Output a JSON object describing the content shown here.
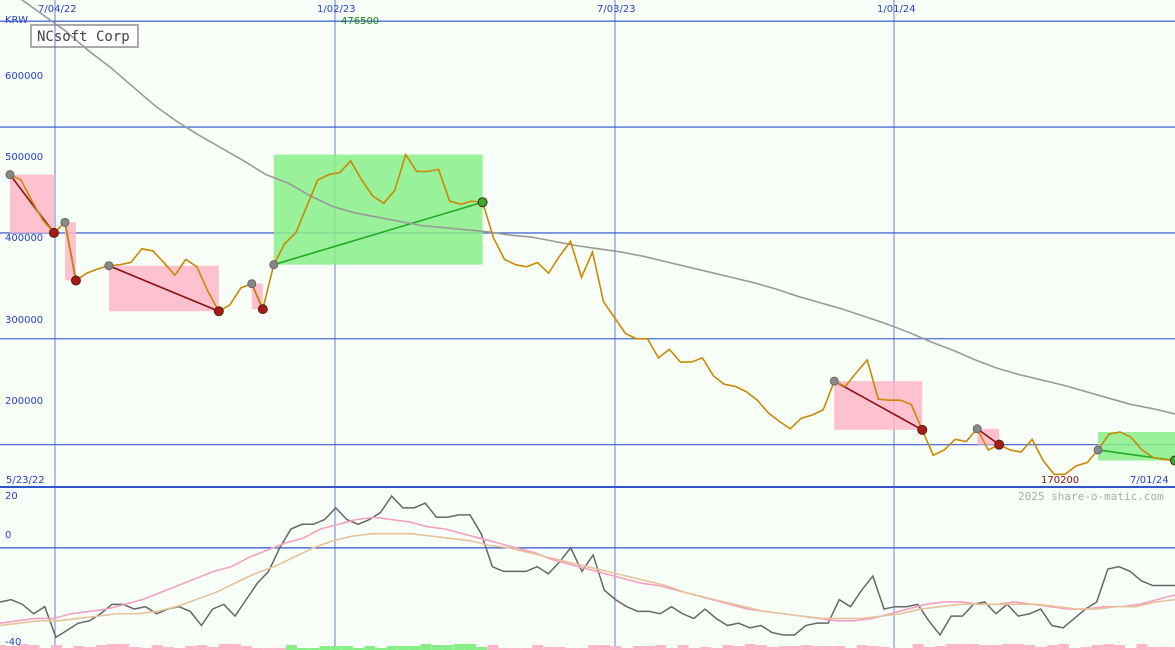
{
  "chart_data": [
    {
      "type": "line",
      "title": "NCsoft Corp",
      "currency": "KRW",
      "x_tick_labels": [
        "7/04/22",
        "1/02/23",
        "7/03/23",
        "1/01/24"
      ],
      "start_date_label": "5/23/22",
      "end_date_label": "7/01/24",
      "y_tick_labels": [
        "600000",
        "500000",
        "400000",
        "300000",
        "200000"
      ],
      "ylim": [
        160000,
        620000
      ],
      "max_label": "476500",
      "min_label": "170200",
      "watermark": "2025 share-o-matic.com",
      "grid": true,
      "colors": {
        "price": "#cc8800",
        "long_ma": "#999999",
        "gain": "#88ee88",
        "loss": "#ffb6c8",
        "down_trend": "#8b1010",
        "up_trend": "#22aa22",
        "grid": "#3355cc"
      },
      "series": [
        {
          "values": [
            455000,
            450000,
            430000,
            412000,
            400000,
            410000,
            355000,
            362000,
            366000,
            369000,
            370000,
            372000,
            385000,
            383000,
            372000,
            360000,
            375000,
            368000,
            345000,
            326000,
            332000,
            348000,
            352000,
            328000,
            370000,
            390000,
            400000,
            425000,
            450000,
            455000,
            457000,
            468000,
            450000,
            435000,
            428000,
            440000,
            474000,
            458000,
            458000,
            460000,
            430000,
            427000,
            430000,
            429000,
            395000,
            375000,
            370000,
            368000,
            372000,
            362000,
            378000,
            392000,
            358000,
            382000,
            335000,
            320000,
            305000,
            300000,
            300000,
            282000,
            290000,
            278000,
            278000,
            282000,
            265000,
            257000,
            255000,
            250000,
            242000,
            230000,
            222000,
            215000,
            225000,
            228000,
            233000,
            260000,
            255000,
            268000,
            280000,
            243000,
            242000,
            242000,
            238000,
            214000,
            190000,
            195000,
            205000,
            203000,
            215000,
            195000,
            200000,
            195000,
            193000,
            205000,
            185000,
            172000,
            172000,
            180000,
            183000,
            195000,
            210000,
            212000,
            207000,
            195000,
            188000,
            186000,
            185000
          ]
        },
        {
          "values": [
            632000,
            620000,
            605000,
            590000,
            572000,
            556000,
            538000,
            520000,
            505000,
            492000,
            480000,
            468000,
            455000,
            447000,
            435000,
            425000,
            419000,
            415000,
            411000,
            407000,
            405000,
            403000,
            401000,
            398000,
            396000,
            392000,
            388000,
            385000,
            382000,
            378000,
            373000,
            368000,
            363000,
            358000,
            353000,
            347000,
            340000,
            334000,
            328000,
            321000,
            314000,
            306000,
            297000,
            289000,
            280000,
            272000,
            266000,
            261000,
            256000,
            250000,
            244000,
            238000,
            234000,
            229000
          ]
        }
      ]
    },
    {
      "type": "line",
      "panel": "oscillator",
      "y_tick_labels": [
        "20",
        "0",
        "-40"
      ],
      "ylim": [
        -40,
        25
      ],
      "series": [
        {
          "values": [
            -23,
            -22,
            -24,
            -28,
            -25,
            -38,
            -35,
            -32,
            -31,
            -28,
            -24,
            -24,
            -26,
            -25,
            -28,
            -26,
            -25,
            -27,
            -33,
            -26,
            -24,
            -29,
            -22,
            -15,
            -10,
            0,
            8,
            10,
            10,
            12,
            17,
            12,
            10,
            12,
            15,
            22,
            17,
            17,
            19,
            13,
            13,
            14,
            14,
            6,
            -8,
            -10,
            -10,
            -10,
            -8,
            -11,
            -6,
            0,
            -10,
            -3,
            -18,
            -22,
            -25,
            -27,
            -27,
            -28,
            -25,
            -28,
            -30,
            -26,
            -30,
            -33,
            -32,
            -34,
            -33,
            -36,
            -37,
            -37,
            -33,
            -32,
            -32,
            -22,
            -25,
            -18,
            -12,
            -26,
            -25,
            -25,
            -24,
            -31,
            -37,
            -29,
            -29,
            -24,
            -23,
            -28,
            -24,
            -29,
            -28,
            -26,
            -33,
            -34,
            -30,
            -26,
            -23,
            -9,
            -8,
            -10,
            -14,
            -16,
            -16,
            -16
          ]
        },
        {
          "values": [
            -32,
            -31,
            -30,
            -30,
            -28,
            -27,
            -26,
            -24,
            -22,
            -19,
            -16,
            -13,
            -10,
            -8,
            -4,
            -1,
            2,
            4,
            8,
            10,
            12,
            13,
            12,
            11,
            9,
            8,
            6,
            4,
            2,
            0,
            -2,
            -5,
            -7,
            -9,
            -11,
            -13,
            -15,
            -16,
            -18,
            -20,
            -22,
            -24,
            -26,
            -27,
            -28,
            -29,
            -30,
            -31,
            -31,
            -30,
            -28,
            -26,
            -24,
            -23,
            -23,
            -24,
            -24,
            -23,
            -24,
            -25,
            -26,
            -26,
            -25,
            -25,
            -24,
            -22,
            -20
          ]
        },
        {
          "values": [
            -33,
            -32,
            -31,
            -31,
            -30,
            -29,
            -28,
            -28,
            -27,
            -25,
            -22,
            -19,
            -15,
            -11,
            -8,
            -4,
            0,
            3,
            5,
            6,
            6,
            6,
            5,
            4,
            3,
            1,
            0,
            -2,
            -4,
            -6,
            -8,
            -10,
            -12,
            -14,
            -16,
            -19,
            -21,
            -23,
            -25,
            -27,
            -28,
            -29,
            -30,
            -30,
            -30,
            -29,
            -28,
            -26,
            -25,
            -24,
            -24,
            -24,
            -24,
            -24,
            -25,
            -26,
            -26,
            -25,
            -25,
            -23,
            -22
          ]
        }
      ]
    }
  ]
}
